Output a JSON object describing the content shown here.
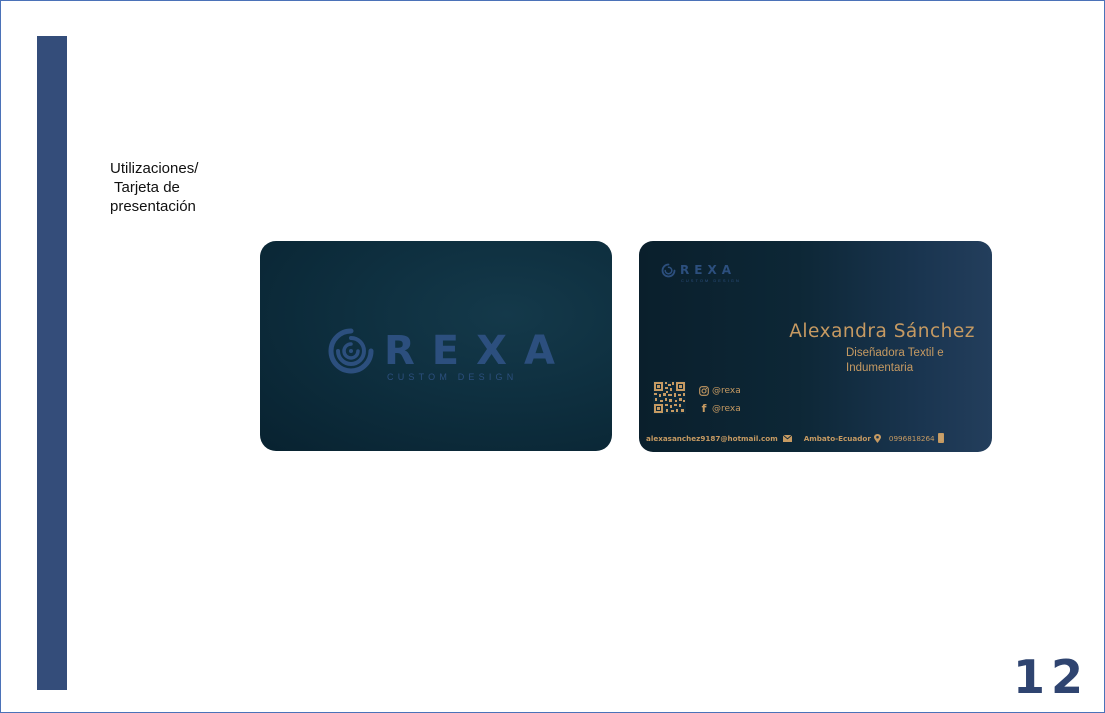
{
  "slide": {
    "caption_line1": "Utilizaciones/",
    "caption_line2": "Tarjeta de",
    "caption_line3": "presentación",
    "page_number": "12"
  },
  "card_front": {
    "brand": "REXA",
    "tagline": "CUSTOM DESIGN"
  },
  "card_back": {
    "brand": "REXA",
    "tagline": "CUSTOM DESIGN",
    "name": "Alexandra Sánchez",
    "role_line1": "Diseñadora Textil e",
    "role_line2": "Indumentaria",
    "instagram": "@rexa",
    "facebook": "@rexa",
    "email": "alexasanchez9187@hotmail.com",
    "location": "Ambato-Ecuador",
    "phone": "0996818264"
  },
  "colors": {
    "accent_bar": "#344d7a",
    "gold_text": "#c69a62",
    "logo_blue": "#2c4f7e",
    "page_number": "#2f4470"
  },
  "icons": [
    "swirl-logo-icon",
    "qr-code-icon",
    "instagram-icon",
    "facebook-icon",
    "mail-icon",
    "location-pin-icon",
    "phone-icon"
  ]
}
